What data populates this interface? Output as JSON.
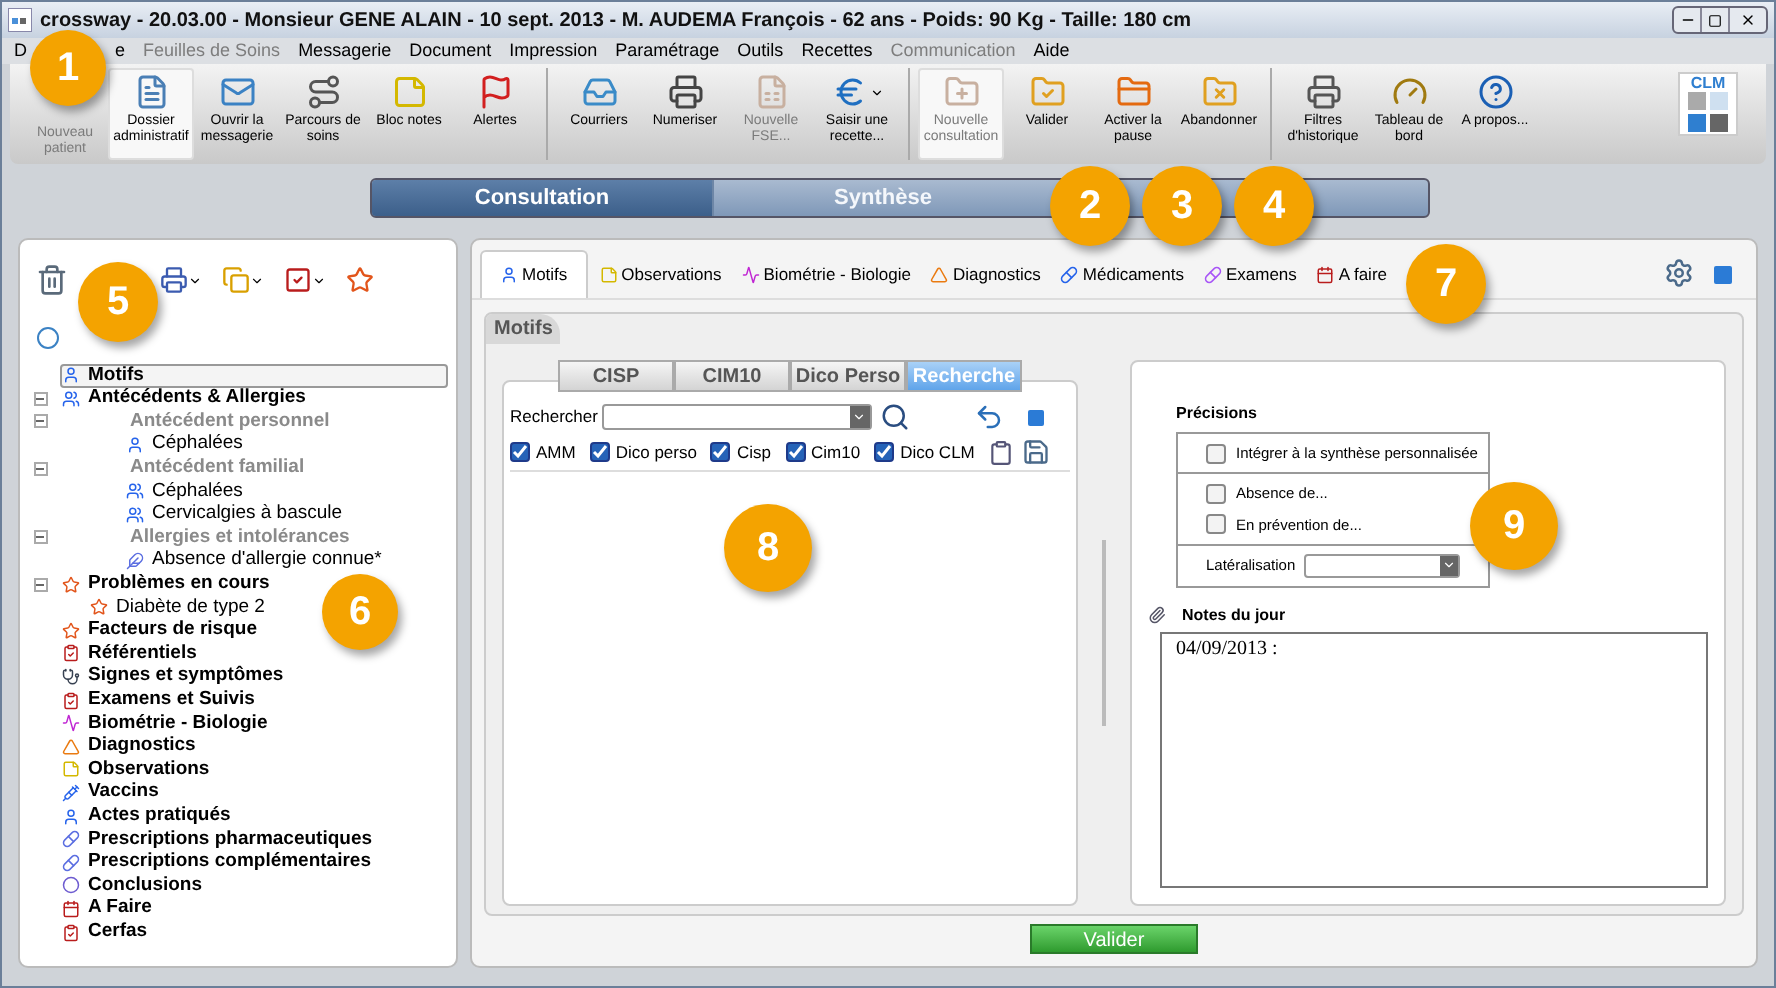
{
  "window": {
    "title": "crossway  - 20.03.00 - Monsieur GENE ALAIN - 10 sept. 2013 - M. AUDEMA François - 62 ans - Poids: 90 Kg - Taille: 180 cm"
  },
  "menu": [
    {
      "label": "D",
      "disabled": false
    },
    {
      "label": "e",
      "disabled": false
    },
    {
      "label": "Feuilles de Soins",
      "disabled": true
    },
    {
      "label": "Messagerie",
      "disabled": false
    },
    {
      "label": "Document",
      "disabled": false
    },
    {
      "label": "Impression",
      "disabled": false
    },
    {
      "label": "Paramétrage",
      "disabled": false
    },
    {
      "label": "Outils",
      "disabled": false
    },
    {
      "label": "Recettes",
      "disabled": false
    },
    {
      "label": "Communication",
      "disabled": true
    },
    {
      "label": "Aide",
      "disabled": false
    }
  ],
  "toolbar": {
    "groups": [
      [
        {
          "label": "Nouveau patient",
          "disabled": true,
          "selected": false,
          "dropdown": false,
          "icon_hidden": true
        },
        {
          "label": "Dossier administratif",
          "disabled": false,
          "selected": true,
          "dropdown": false,
          "icon_hidden": false
        },
        {
          "label": "Ouvrir la messagerie",
          "disabled": false,
          "selected": false,
          "dropdown": false,
          "icon_hidden": false
        },
        {
          "label": "Parcours de soins",
          "disabled": false,
          "selected": false,
          "dropdown": false,
          "icon_hidden": false
        },
        {
          "label": "Bloc notes",
          "disabled": false,
          "selected": false,
          "dropdown": false,
          "icon_hidden": false
        },
        {
          "label": "Alertes",
          "disabled": false,
          "selected": false,
          "dropdown": false,
          "icon_hidden": false
        }
      ],
      [
        {
          "label": "Courriers",
          "disabled": false,
          "selected": false,
          "dropdown": false,
          "icon_hidden": false
        },
        {
          "label": "Numeriser",
          "disabled": false,
          "selected": false,
          "dropdown": false,
          "icon_hidden": false
        },
        {
          "label": "Nouvelle FSE...",
          "disabled": true,
          "selected": false,
          "dropdown": false,
          "icon_hidden": false
        },
        {
          "label": "Saisir une recette...",
          "disabled": false,
          "selected": false,
          "dropdown": true,
          "icon_hidden": false
        }
      ],
      [
        {
          "label": "Nouvelle consultation",
          "disabled": true,
          "selected": true,
          "dropdown": false,
          "icon_hidden": false
        },
        {
          "label": "Valider",
          "disabled": false,
          "selected": false,
          "dropdown": false,
          "icon_hidden": false
        },
        {
          "label": "Activer la pause",
          "disabled": false,
          "selected": false,
          "dropdown": false,
          "icon_hidden": false
        },
        {
          "label": "Abandonner",
          "disabled": false,
          "selected": false,
          "dropdown": false,
          "icon_hidden": false
        }
      ],
      [
        {
          "label": "Filtres d'historique",
          "disabled": false,
          "selected": false,
          "dropdown": false,
          "icon_hidden": false
        },
        {
          "label": "Tableau de bord",
          "disabled": false,
          "selected": false,
          "dropdown": false,
          "icon_hidden": false
        },
        {
          "label": "A propos...",
          "disabled": false,
          "selected": false,
          "dropdown": false,
          "icon_hidden": false
        }
      ]
    ],
    "logo": "CLM"
  },
  "view_tabs": [
    {
      "label": "Consultation",
      "selected": true
    },
    {
      "label": "Synthèse",
      "selected": false
    }
  ],
  "tree": [
    {
      "label": "Motifs",
      "kind": "item",
      "selected": true
    },
    {
      "label": "Antécédents & Allergies",
      "kind": "item",
      "selected": false,
      "expanded": true,
      "children": [
        {
          "label": "Antécédent personnel",
          "kind": "group",
          "selected": false,
          "expanded": true,
          "children": [
            {
              "label": "Céphalées",
              "kind": "leaf",
              "selected": false
            }
          ]
        },
        {
          "label": "Antécédent familial",
          "kind": "group",
          "selected": false,
          "expanded": true,
          "children": [
            {
              "label": "Céphalées",
              "kind": "leaf",
              "selected": false
            },
            {
              "label": "Cervicalgies à bascule",
              "kind": "leaf",
              "selected": false
            }
          ]
        },
        {
          "label": "Allergies et intolérances",
          "kind": "group",
          "selected": false,
          "expanded": true,
          "children": [
            {
              "label": "Absence d'allergie connue*",
              "kind": "leaf",
              "selected": false
            }
          ]
        }
      ]
    },
    {
      "label": "Problèmes en cours",
      "kind": "item",
      "selected": false,
      "expanded": true,
      "children": [
        {
          "label": "Diabète de type 2",
          "kind": "leaf",
          "selected": false
        }
      ]
    },
    {
      "label": "Facteurs de risque",
      "kind": "item",
      "selected": false
    },
    {
      "label": "Référentiels",
      "kind": "item",
      "selected": false
    },
    {
      "label": "Signes et symptômes",
      "kind": "item",
      "selected": false
    },
    {
      "label": "Examens et Suivis",
      "kind": "item",
      "selected": false
    },
    {
      "label": "Biométrie - Biologie",
      "kind": "item",
      "selected": false
    },
    {
      "label": "Diagnostics",
      "kind": "item",
      "selected": false
    },
    {
      "label": "Observations",
      "kind": "item",
      "selected": false
    },
    {
      "label": "Vaccins",
      "kind": "item",
      "selected": false
    },
    {
      "label": "Actes pratiqués",
      "kind": "item",
      "selected": false
    },
    {
      "label": "Prescriptions pharmaceutiques",
      "kind": "item",
      "selected": false
    },
    {
      "label": "Prescriptions complémentaires",
      "kind": "item",
      "selected": false
    },
    {
      "label": "Conclusions",
      "kind": "item",
      "selected": false
    },
    {
      "label": "A Faire",
      "kind": "item",
      "selected": false
    },
    {
      "label": "Cerfas",
      "kind": "item",
      "selected": false
    }
  ],
  "section_tabs": [
    {
      "label": "Motifs",
      "selected": true
    },
    {
      "label": "Observations",
      "selected": false
    },
    {
      "label": "Biométrie - Biologie",
      "selected": false
    },
    {
      "label": "Diagnostics",
      "selected": false
    },
    {
      "label": "Médicaments",
      "selected": false
    },
    {
      "label": "Examens",
      "selected": false
    },
    {
      "label": "A faire",
      "selected": false
    }
  ],
  "section_title": "Motifs",
  "source_tabs": [
    {
      "label": "CISP",
      "selected": false
    },
    {
      "label": "CIM10",
      "selected": false
    },
    {
      "label": "Dico Perso",
      "selected": false
    },
    {
      "label": "Recherche",
      "selected": true
    }
  ],
  "search": {
    "label": "Rechercher"
  },
  "filters": [
    {
      "label": "AMM",
      "checked": true
    },
    {
      "label": "Dico perso",
      "checked": true
    },
    {
      "label": "Cisp",
      "checked": true
    },
    {
      "label": "Cim10",
      "checked": true
    },
    {
      "label": "Dico CLM",
      "checked": true
    }
  ],
  "precisions": {
    "title": "Précisions",
    "groups": [
      [
        {
          "label": "Intégrer à la synthèse personnalisée",
          "checked": false
        }
      ],
      [
        {
          "label": "Absence de...",
          "checked": false
        },
        {
          "label": "En prévention de...",
          "checked": false
        }
      ]
    ],
    "lateralisation_label": "Latéralisation"
  },
  "notes": {
    "title": "Notes du jour",
    "value": "04/09/2013 :"
  },
  "validate_button": "Valider",
  "callouts": [
    "1",
    "2",
    "3",
    "4",
    "5",
    "6",
    "7",
    "8",
    "9"
  ]
}
